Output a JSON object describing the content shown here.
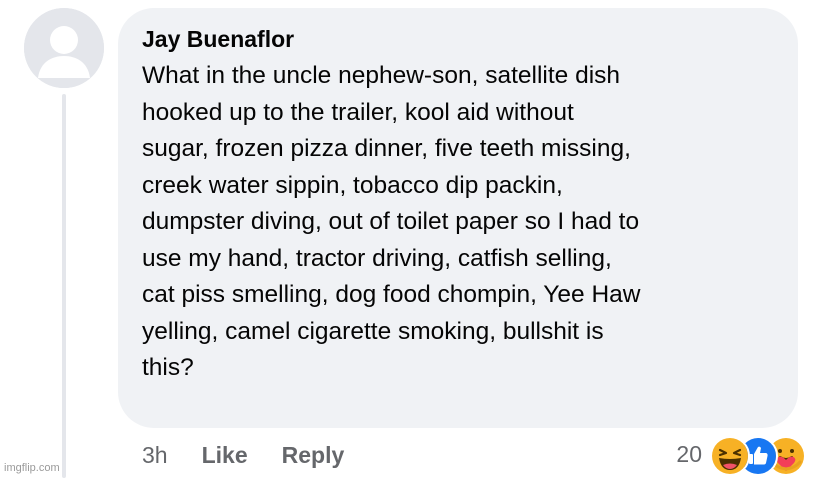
{
  "comment": {
    "author": "Jay Buenaflor",
    "text": "What in the uncle nephew-son, satellite dish\nhooked up to the trailer, kool aid without\nsugar, frozen pizza dinner, five teeth missing,\ncreek water sippin, tobacco dip packin,\ndumpster diving, out of toilet paper so I had to\nuse my hand, tractor driving, catfish selling,\ncat piss smelling, dog food chompin, Yee Haw\nyelling, camel cigarette smoking, bullshit is\nthis?"
  },
  "actions": {
    "time": "3h",
    "like_label": "Like",
    "reply_label": "Reply"
  },
  "reactions": {
    "count": "20",
    "icons": [
      "haha-icon",
      "like-icon",
      "care-icon"
    ]
  },
  "watermark": "imgflip.com",
  "colors": {
    "bubble": "#f0f2f5",
    "text": "#050505",
    "meta": "#65676b",
    "like_blue": "#1877f2",
    "haha_yellow": "#f7b125"
  }
}
